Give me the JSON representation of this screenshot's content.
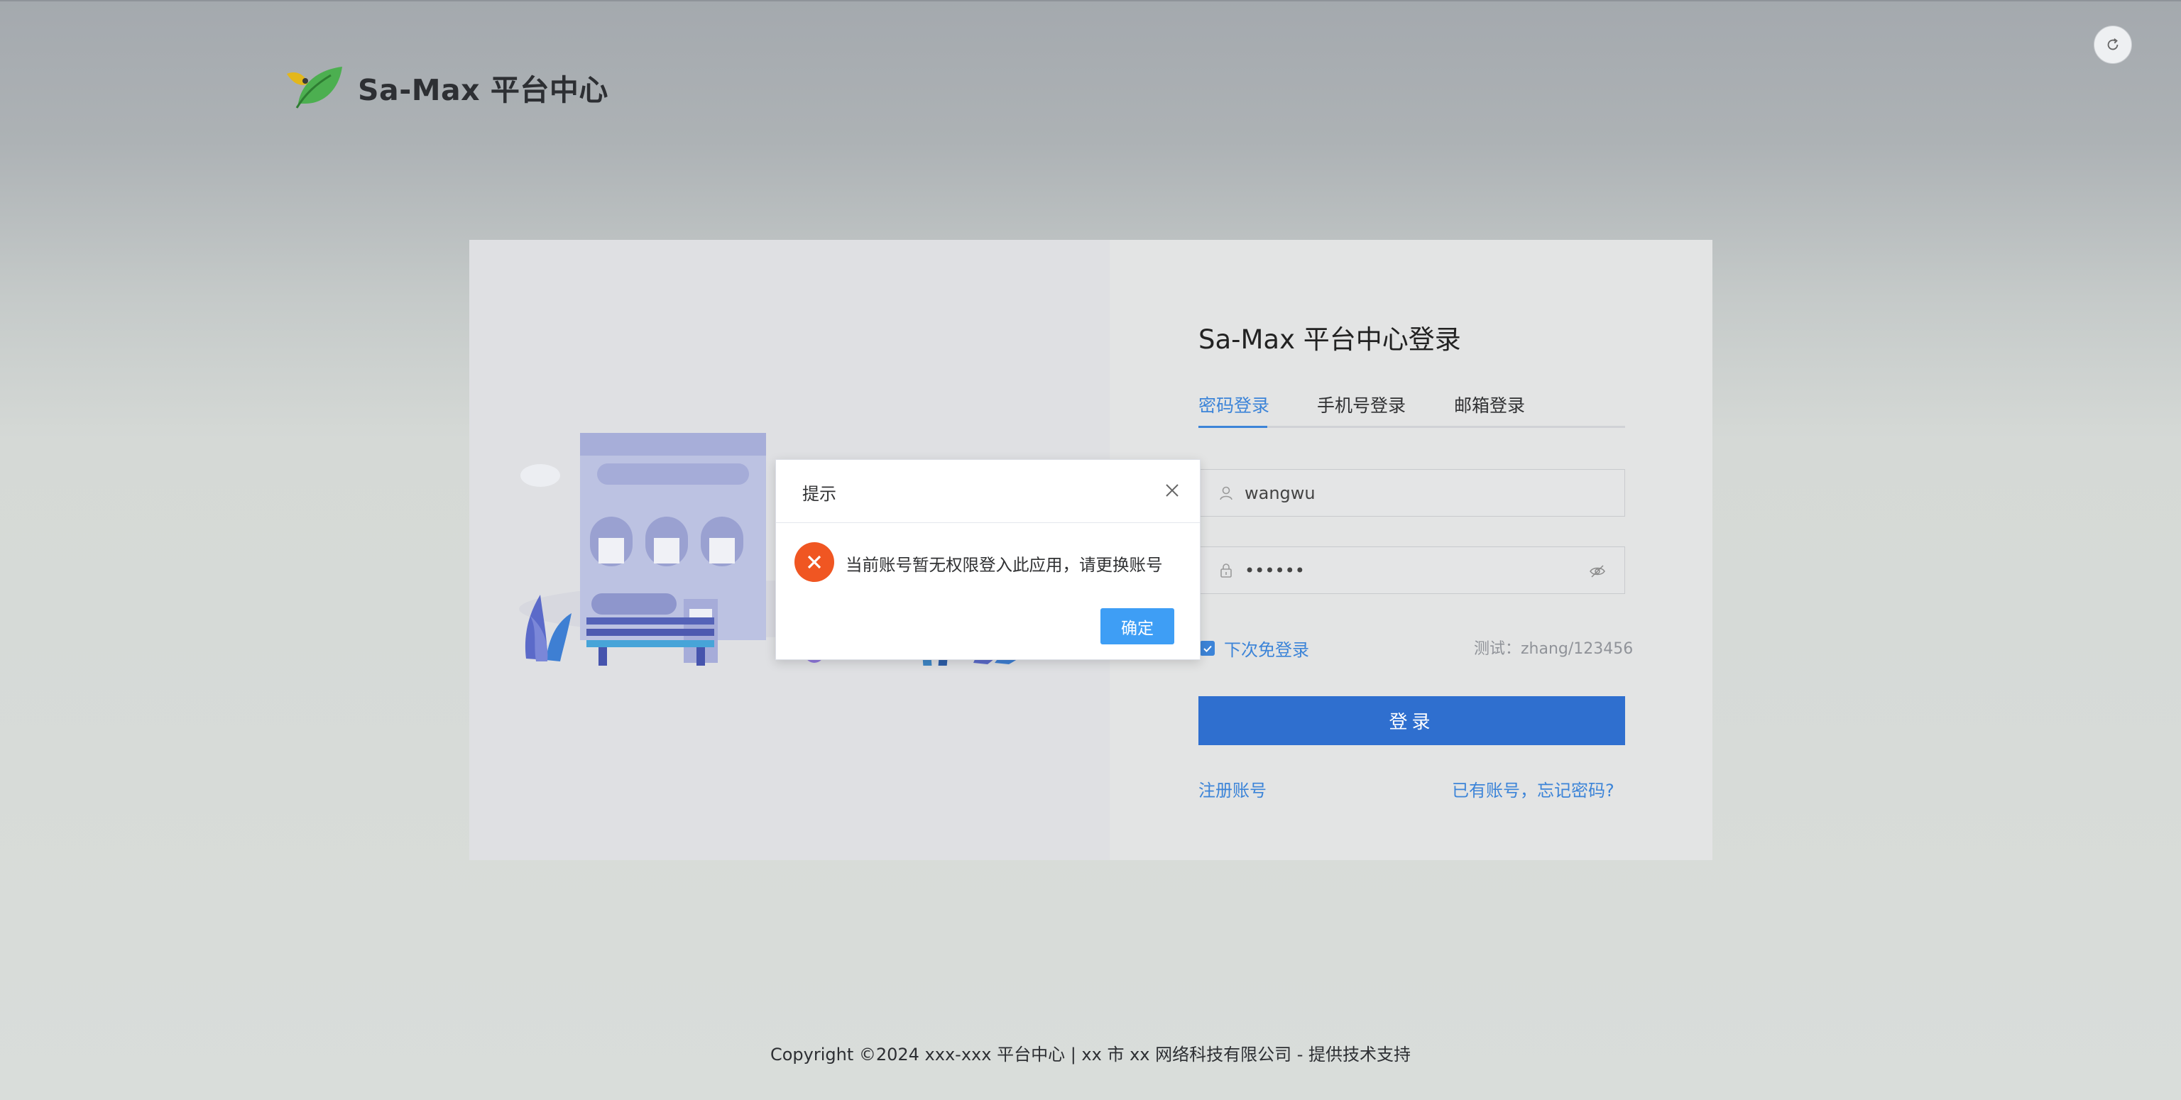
{
  "brand": {
    "name": "Sa-Max 平台中心"
  },
  "login": {
    "title": "Sa-Max 平台中心登录",
    "tabs": [
      {
        "label": "密码登录",
        "active": true
      },
      {
        "label": "手机号登录",
        "active": false
      },
      {
        "label": "邮箱登录",
        "active": false
      }
    ],
    "username": "wangwu",
    "password_masked": "••••••",
    "remember_label": "下次免登录",
    "remember_checked": true,
    "hint": "测试：zhang/123456",
    "submit_label": "登录",
    "register_link": "注册账号",
    "forgot_link": "已有账号，忘记密码?"
  },
  "dialog": {
    "title": "提示",
    "message": "当前账号暂无权限登入此应用，请更换账号",
    "confirm_label": "确定"
  },
  "footer": {
    "copyright": "Copyright ©2024 xxx-xxx 平台中心 | xx 市 xx 网络科技有限公司 - 提供技术支持"
  },
  "colors": {
    "accent": "#3c84d8",
    "primary_button": "#2f6fcf",
    "error": "#f05622",
    "dialog_button": "#3e9ef5"
  }
}
